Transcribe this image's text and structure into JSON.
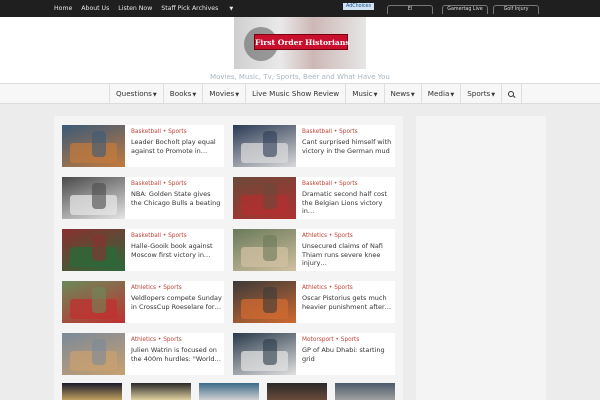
{
  "topbar": {
    "nav": [
      "Home",
      "About Us",
      "Listen Now",
      "Staff Pick Archives"
    ],
    "adchoices": "AdChoices",
    "pills": [
      "El",
      "Gamertag Live",
      "Golf Injury"
    ]
  },
  "header": {
    "logo_text": "First Order Historians",
    "tagline": "Movies, Music, Tv, Sports, Beer and What Have You"
  },
  "mainnav": {
    "items": [
      "Questions",
      "Books",
      "Movies",
      "Live Music Show Review",
      "Music",
      "News",
      "Media",
      "Sports"
    ]
  },
  "articles": [
    {
      "category": "Basketball",
      "section": "Sports",
      "title": "Leader Bocholt play equal against to Promote in…",
      "colors": [
        "#3a5a7a",
        "#c27a3c"
      ]
    },
    {
      "category": "Basketball",
      "section": "Sports",
      "title": "Cant surprised himself with victory in the German mud",
      "colors": [
        "#2b3a55",
        "#d9d9d9"
      ]
    },
    {
      "category": "Basketball",
      "section": "Sports",
      "title": "NBA: Golden State gives the Chicago Bulls a beating",
      "colors": [
        "#4a4a4a",
        "#e5e5e5"
      ]
    },
    {
      "category": "Basketball",
      "section": "Sports",
      "title": "Dramatic second half cost the Belgian Lions victory in…",
      "colors": [
        "#6b4a3a",
        "#b03030"
      ]
    },
    {
      "category": "Basketball",
      "section": "Sports",
      "title": "Halle-Gooik book against Moscow first victory in…",
      "colors": [
        "#8a3030",
        "#2a6a3a"
      ]
    },
    {
      "category": "Athletics",
      "section": "Sports",
      "title": "Unsecured claims of Nafi Thiam runs severe knee injury…",
      "colors": [
        "#6a7a5a",
        "#d0c0a0"
      ]
    },
    {
      "category": "Athletics",
      "section": "Sports",
      "title": "Veldlopers compete Sunday in CrossCup Roeselare for…",
      "colors": [
        "#6a8a5a",
        "#c03030"
      ]
    },
    {
      "category": "Athletics",
      "section": "Sports",
      "title": "Oscar Pistorius gets much heavier punishment after…",
      "colors": [
        "#3a3a3a",
        "#d06a30"
      ]
    },
    {
      "category": "Athletics",
      "section": "Sports",
      "title": "Julien Watrin is focused on the 400m hurdles: \"World…",
      "colors": [
        "#7a8a9a",
        "#c8a070"
      ]
    },
    {
      "category": "Motorsport",
      "section": "Sports",
      "title": "GP of Abu Dhabi: starting grid",
      "colors": [
        "#2a3a4a",
        "#e0e0e0"
      ]
    }
  ],
  "bottom_thumbs": [
    {
      "colors": [
        "#1a1a2a",
        "#c0a060"
      ]
    },
    {
      "colors": [
        "#2a2a2a",
        "#e0d0a0"
      ]
    },
    {
      "colors": [
        "#3a6a8a",
        "#d0d0d0"
      ]
    },
    {
      "colors": [
        "#2a2a2a",
        "#6a4a3a"
      ]
    },
    {
      "colors": [
        "#4a5a6a",
        "#a0a0a0"
      ]
    }
  ]
}
